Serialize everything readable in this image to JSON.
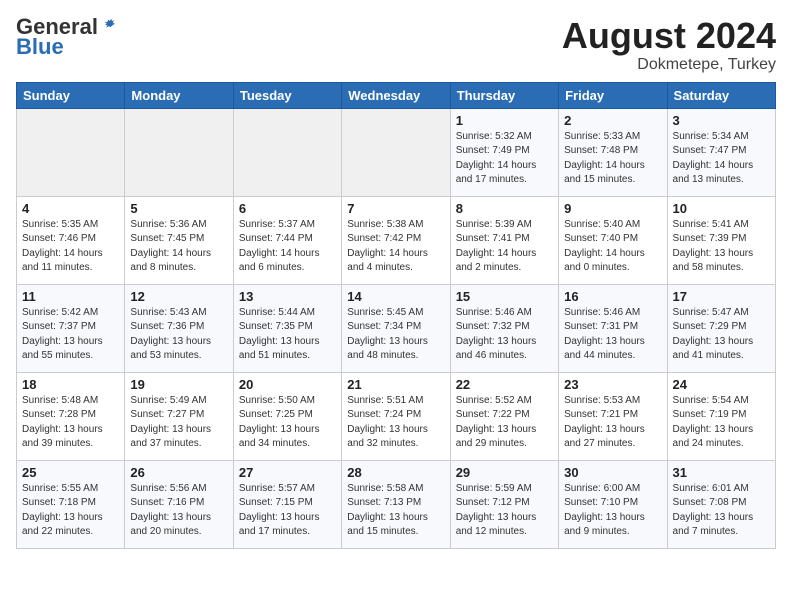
{
  "header": {
    "logo_general": "General",
    "logo_blue": "Blue",
    "month_year": "August 2024",
    "location": "Dokmetepe, Turkey"
  },
  "days_of_week": [
    "Sunday",
    "Monday",
    "Tuesday",
    "Wednesday",
    "Thursday",
    "Friday",
    "Saturday"
  ],
  "weeks": [
    [
      {
        "day": "",
        "info": ""
      },
      {
        "day": "",
        "info": ""
      },
      {
        "day": "",
        "info": ""
      },
      {
        "day": "",
        "info": ""
      },
      {
        "day": "1",
        "info": "Sunrise: 5:32 AM\nSunset: 7:49 PM\nDaylight: 14 hours\nand 17 minutes."
      },
      {
        "day": "2",
        "info": "Sunrise: 5:33 AM\nSunset: 7:48 PM\nDaylight: 14 hours\nand 15 minutes."
      },
      {
        "day": "3",
        "info": "Sunrise: 5:34 AM\nSunset: 7:47 PM\nDaylight: 14 hours\nand 13 minutes."
      }
    ],
    [
      {
        "day": "4",
        "info": "Sunrise: 5:35 AM\nSunset: 7:46 PM\nDaylight: 14 hours\nand 11 minutes."
      },
      {
        "day": "5",
        "info": "Sunrise: 5:36 AM\nSunset: 7:45 PM\nDaylight: 14 hours\nand 8 minutes."
      },
      {
        "day": "6",
        "info": "Sunrise: 5:37 AM\nSunset: 7:44 PM\nDaylight: 14 hours\nand 6 minutes."
      },
      {
        "day": "7",
        "info": "Sunrise: 5:38 AM\nSunset: 7:42 PM\nDaylight: 14 hours\nand 4 minutes."
      },
      {
        "day": "8",
        "info": "Sunrise: 5:39 AM\nSunset: 7:41 PM\nDaylight: 14 hours\nand 2 minutes."
      },
      {
        "day": "9",
        "info": "Sunrise: 5:40 AM\nSunset: 7:40 PM\nDaylight: 14 hours\nand 0 minutes."
      },
      {
        "day": "10",
        "info": "Sunrise: 5:41 AM\nSunset: 7:39 PM\nDaylight: 13 hours\nand 58 minutes."
      }
    ],
    [
      {
        "day": "11",
        "info": "Sunrise: 5:42 AM\nSunset: 7:37 PM\nDaylight: 13 hours\nand 55 minutes."
      },
      {
        "day": "12",
        "info": "Sunrise: 5:43 AM\nSunset: 7:36 PM\nDaylight: 13 hours\nand 53 minutes."
      },
      {
        "day": "13",
        "info": "Sunrise: 5:44 AM\nSunset: 7:35 PM\nDaylight: 13 hours\nand 51 minutes."
      },
      {
        "day": "14",
        "info": "Sunrise: 5:45 AM\nSunset: 7:34 PM\nDaylight: 13 hours\nand 48 minutes."
      },
      {
        "day": "15",
        "info": "Sunrise: 5:46 AM\nSunset: 7:32 PM\nDaylight: 13 hours\nand 46 minutes."
      },
      {
        "day": "16",
        "info": "Sunrise: 5:46 AM\nSunset: 7:31 PM\nDaylight: 13 hours\nand 44 minutes."
      },
      {
        "day": "17",
        "info": "Sunrise: 5:47 AM\nSunset: 7:29 PM\nDaylight: 13 hours\nand 41 minutes."
      }
    ],
    [
      {
        "day": "18",
        "info": "Sunrise: 5:48 AM\nSunset: 7:28 PM\nDaylight: 13 hours\nand 39 minutes."
      },
      {
        "day": "19",
        "info": "Sunrise: 5:49 AM\nSunset: 7:27 PM\nDaylight: 13 hours\nand 37 minutes."
      },
      {
        "day": "20",
        "info": "Sunrise: 5:50 AM\nSunset: 7:25 PM\nDaylight: 13 hours\nand 34 minutes."
      },
      {
        "day": "21",
        "info": "Sunrise: 5:51 AM\nSunset: 7:24 PM\nDaylight: 13 hours\nand 32 minutes."
      },
      {
        "day": "22",
        "info": "Sunrise: 5:52 AM\nSunset: 7:22 PM\nDaylight: 13 hours\nand 29 minutes."
      },
      {
        "day": "23",
        "info": "Sunrise: 5:53 AM\nSunset: 7:21 PM\nDaylight: 13 hours\nand 27 minutes."
      },
      {
        "day": "24",
        "info": "Sunrise: 5:54 AM\nSunset: 7:19 PM\nDaylight: 13 hours\nand 24 minutes."
      }
    ],
    [
      {
        "day": "25",
        "info": "Sunrise: 5:55 AM\nSunset: 7:18 PM\nDaylight: 13 hours\nand 22 minutes."
      },
      {
        "day": "26",
        "info": "Sunrise: 5:56 AM\nSunset: 7:16 PM\nDaylight: 13 hours\nand 20 minutes."
      },
      {
        "day": "27",
        "info": "Sunrise: 5:57 AM\nSunset: 7:15 PM\nDaylight: 13 hours\nand 17 minutes."
      },
      {
        "day": "28",
        "info": "Sunrise: 5:58 AM\nSunset: 7:13 PM\nDaylight: 13 hours\nand 15 minutes."
      },
      {
        "day": "29",
        "info": "Sunrise: 5:59 AM\nSunset: 7:12 PM\nDaylight: 13 hours\nand 12 minutes."
      },
      {
        "day": "30",
        "info": "Sunrise: 6:00 AM\nSunset: 7:10 PM\nDaylight: 13 hours\nand 9 minutes."
      },
      {
        "day": "31",
        "info": "Sunrise: 6:01 AM\nSunset: 7:08 PM\nDaylight: 13 hours\nand 7 minutes."
      }
    ]
  ]
}
